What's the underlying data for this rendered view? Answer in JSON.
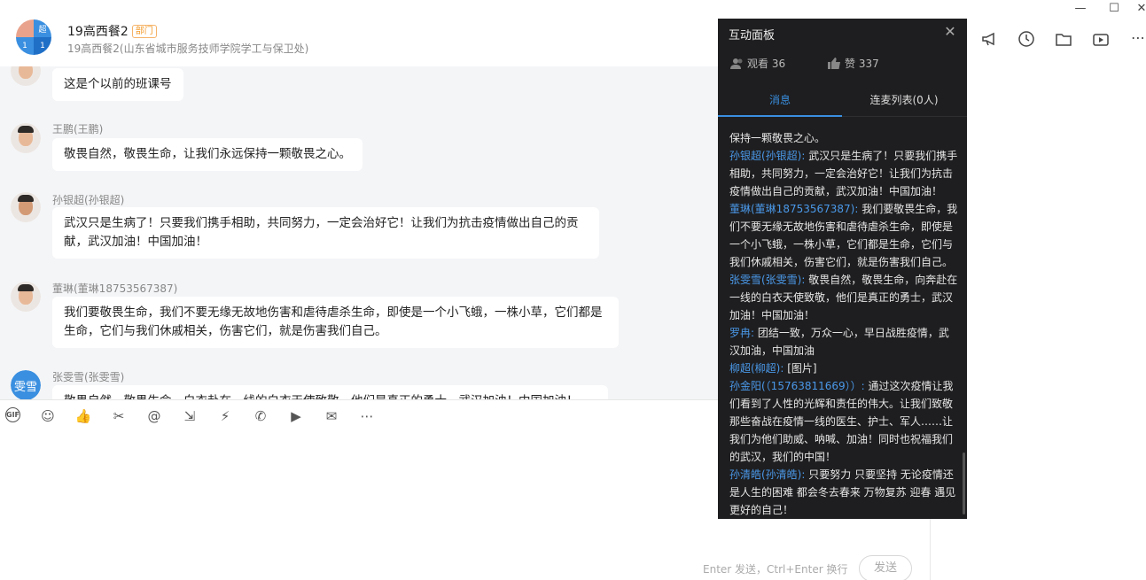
{
  "header": {
    "title": "19高西餐2",
    "badge": "部门",
    "subtitle": "19高西餐2(山东省城市服务技师学院学工与保卫处)",
    "avatar_cells": [
      "",
      "超",
      "1",
      "1"
    ]
  },
  "messages": [
    {
      "sender": "",
      "text": "这是个以前的班课号"
    },
    {
      "sender": "王鹏(王鹏)",
      "text": "敬畏自然，敬畏生命，让我们永远保持一颗敬畏之心。"
    },
    {
      "sender": "孙银超(孙银超)",
      "text": "武汉只是生病了！只要我们携手相助，共同努力，一定会治好它！让我们为抗击疫情做出自己的贡献，武汉加油！中国加油！"
    },
    {
      "sender": "董琳(董琳18753567387)",
      "text": "我们要敬畏生命，我们不要无缘无故地伤害和虐待虐杀生命，即使是一个小飞蛾，一株小草，它们都是生命，它们与我们休戚相关，伤害它们，就是伤害我们自己。"
    },
    {
      "sender": "张雯雪(张雯雪)",
      "avatar_text": "雯雪",
      "text": "敬畏自然，敬畏生命，白衣赴在一线的白衣天使致敬，他们是真正的勇士，武汉加油！中国加油！"
    }
  ],
  "toolbar": {
    "gif": "GIF",
    "icons": [
      "emoji-icon",
      "like-icon",
      "scissors-icon",
      "mention-icon",
      "file-icon",
      "flash-icon",
      "call-icon",
      "video-icon",
      "mail-icon",
      "more-icon"
    ]
  },
  "input": {
    "hint": "Enter 发送，Ctrl+Enter 换行",
    "send": "发送"
  },
  "panel": {
    "title": "互动面板",
    "viewers_label": "观看 36",
    "likes_label": "赞 337",
    "tab_messages": "消息",
    "tab_mic": "连麦列表(0人)",
    "items": [
      {
        "name": "",
        "text": "保持一颗敬畏之心。"
      },
      {
        "name": "孙银超(孙银超):",
        "text": "武汉只是生病了！只要我们携手相助，共同努力，一定会治好它！让我们为抗击疫情做出自己的贡献，武汉加油！中国加油！"
      },
      {
        "name": "董琳(董琳18753567387):",
        "text": "我们要敬畏生命，我们不要无缘无故地伤害和虐待虐杀生命，即使是一个小飞蛾，一株小草，它们都是生命，它们与我们休戚相关，伤害它们，就是伤害我们自己。"
      },
      {
        "name": "张雯雪(张雯雪):",
        "text": "敬畏自然，敬畏生命，向奔赴在一线的白衣天使致敬，他们是真正的勇士，武汉加油！中国加油！"
      },
      {
        "name": "罗冉:",
        "text": "团结一致，万众一心，早日战胜疫情，武汉加油，中国加油"
      },
      {
        "name": "柳超(柳超):",
        "text": "[图片]"
      },
      {
        "name": "孙金阳(（15763811669））:",
        "text": "通过这次疫情让我们看到了人性的光辉和责任的伟大。让我们致敬那些奋战在疫情一线的医生、护士、军人……让我们为他们助威、呐喊、加油！同时也祝福我们的武汉，我们的中国！"
      },
      {
        "name": "孙清皓(孙清皓):",
        "text": "只要努力 只要坚持 无论疫情还是人生的困难 都会冬去春来 万物复苏 迎春 遇见更好的自己！"
      }
    ]
  },
  "window": {
    "minimize": "—",
    "maximize": "☐",
    "close": "✕"
  }
}
